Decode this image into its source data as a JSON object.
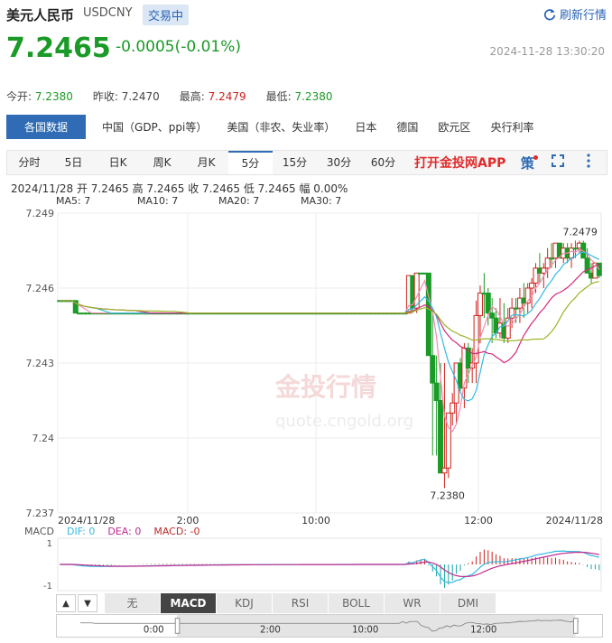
{
  "header": {
    "title": "美元人民币",
    "symbol": "USDCNY",
    "status": "交易中",
    "refresh_label": "刷新行情"
  },
  "quote": {
    "price": "7.2465",
    "change": "-0.0005(-0.01%)",
    "timestamp": "2024-11-28 13:30:20"
  },
  "stats": [
    {
      "label": "今开:",
      "value": "7.2380",
      "tone": "green"
    },
    {
      "label": "昨收:",
      "value": "7.2470",
      "tone": "neutral"
    },
    {
      "label": "最高:",
      "value": "7.2479",
      "tone": "red"
    },
    {
      "label": "最低:",
      "value": "7.2380",
      "tone": "green"
    }
  ],
  "categories": [
    "各国数据",
    "中国（GDP、ppi等）",
    "美国（非农、失业率）",
    "日本",
    "德国",
    "欧元区",
    "央行利率"
  ],
  "tabs": [
    "分时",
    "5日",
    "日K",
    "周K",
    "月K",
    "5分",
    "15分",
    "30分",
    "60分"
  ],
  "active_tab": "5分",
  "promo": "打开金投网APP",
  "bar_info": "2024/11/28  开 7.2465  高 7.2465  收 7.2465  低 7.2465  幅 0.00%",
  "ma_labels": [
    {
      "text": "MA5: 7",
      "color": "#f58bb0"
    },
    {
      "text": "MA10: 7",
      "color": "#33b9e0"
    },
    {
      "text": "MA20: 7",
      "color": "#d6287a"
    },
    {
      "text": "MA30: 7",
      "color": "#9ab526"
    }
  ],
  "macd_labels": [
    {
      "text": "MACD",
      "color": "#555"
    },
    {
      "text": "DIF: 0",
      "color": "#33b9e0"
    },
    {
      "text": "DEA: 0",
      "color": "#c02a8e"
    },
    {
      "text": "MACD: -0",
      "color": "#c02a2a"
    }
  ],
  "indicators": [
    "无",
    "MACD",
    "KDJ",
    "RSI",
    "BOLL",
    "WR",
    "DMI"
  ],
  "active_indicator": "MACD",
  "navigator_labels": [
    "0:00",
    "2:00",
    "10:00",
    "12:00"
  ],
  "watermark": "金投行情  quote.cngold.org",
  "chart_data": {
    "type": "candlestick",
    "y_ticks": [
      "7.249",
      "7.246",
      "7.243",
      "7.24",
      "7.237"
    ],
    "ylim": [
      7.237,
      7.249
    ],
    "x_ticks": [
      "2024/11/28",
      "2:00",
      "10:00",
      "12:00",
      "2024/11/28"
    ],
    "high_label": "7.2479",
    "low_label": "7.2380",
    "macd_axis": [
      "1",
      "-1"
    ],
    "candles": [
      [
        7.2455,
        7.2455,
        7.2455,
        7.2455
      ],
      [
        7.2455,
        7.2455,
        7.2455,
        7.2455
      ],
      [
        7.2455,
        7.2455,
        7.2455,
        7.2455
      ],
      [
        7.2455,
        7.2455,
        7.2455,
        7.2455
      ],
      [
        7.2455,
        7.2455,
        7.245,
        7.245
      ],
      [
        7.245,
        7.245,
        7.245,
        7.245
      ],
      [
        7.245,
        7.245,
        7.245,
        7.245
      ],
      [
        7.245,
        7.245,
        7.245,
        7.245
      ],
      [
        7.245,
        7.245,
        7.245,
        7.245
      ],
      [
        7.245,
        7.245,
        7.245,
        7.245
      ],
      [
        7.245,
        7.245,
        7.245,
        7.245
      ],
      [
        7.245,
        7.245,
        7.245,
        7.245
      ],
      [
        7.245,
        7.245,
        7.245,
        7.245
      ],
      [
        7.245,
        7.245,
        7.245,
        7.245
      ],
      [
        7.245,
        7.245,
        7.245,
        7.245
      ],
      [
        7.245,
        7.245,
        7.245,
        7.245
      ],
      [
        7.245,
        7.245,
        7.245,
        7.245
      ],
      [
        7.245,
        7.245,
        7.245,
        7.245
      ],
      [
        7.245,
        7.245,
        7.245,
        7.245
      ],
      [
        7.245,
        7.245,
        7.245,
        7.245
      ],
      [
        7.245,
        7.245,
        7.245,
        7.245
      ],
      [
        7.245,
        7.245,
        7.245,
        7.245
      ],
      [
        7.245,
        7.245,
        7.245,
        7.245
      ],
      [
        7.245,
        7.245,
        7.245,
        7.245
      ],
      [
        7.245,
        7.245,
        7.245,
        7.245
      ],
      [
        7.245,
        7.245,
        7.245,
        7.245
      ],
      [
        7.245,
        7.245,
        7.245,
        7.245
      ],
      [
        7.245,
        7.245,
        7.245,
        7.245
      ],
      [
        7.245,
        7.245,
        7.245,
        7.245
      ],
      [
        7.245,
        7.245,
        7.245,
        7.245
      ],
      [
        7.245,
        7.245,
        7.245,
        7.245
      ],
      [
        7.245,
        7.245,
        7.245,
        7.245
      ],
      [
        7.245,
        7.245,
        7.245,
        7.245
      ],
      [
        7.245,
        7.245,
        7.245,
        7.245
      ],
      [
        7.245,
        7.245,
        7.245,
        7.245
      ],
      [
        7.245,
        7.245,
        7.245,
        7.245
      ],
      [
        7.245,
        7.245,
        7.245,
        7.245
      ],
      [
        7.245,
        7.245,
        7.245,
        7.245
      ],
      [
        7.245,
        7.245,
        7.245,
        7.245
      ],
      [
        7.245,
        7.245,
        7.245,
        7.245
      ],
      [
        7.245,
        7.245,
        7.245,
        7.245
      ],
      [
        7.245,
        7.245,
        7.245,
        7.245
      ],
      [
        7.245,
        7.245,
        7.245,
        7.245
      ],
      [
        7.245,
        7.245,
        7.245,
        7.245
      ],
      [
        7.245,
        7.245,
        7.245,
        7.245
      ],
      [
        7.245,
        7.245,
        7.245,
        7.245
      ],
      [
        7.245,
        7.245,
        7.245,
        7.245
      ],
      [
        7.245,
        7.245,
        7.245,
        7.245
      ],
      [
        7.245,
        7.245,
        7.245,
        7.245
      ],
      [
        7.245,
        7.245,
        7.245,
        7.245
      ],
      [
        7.245,
        7.245,
        7.245,
        7.245
      ],
      [
        7.245,
        7.245,
        7.245,
        7.245
      ],
      [
        7.245,
        7.245,
        7.245,
        7.245
      ],
      [
        7.245,
        7.245,
        7.245,
        7.245
      ],
      [
        7.245,
        7.245,
        7.245,
        7.245
      ],
      [
        7.245,
        7.245,
        7.245,
        7.245
      ],
      [
        7.245,
        7.245,
        7.245,
        7.245
      ],
      [
        7.245,
        7.245,
        7.245,
        7.245
      ],
      [
        7.245,
        7.245,
        7.245,
        7.245
      ],
      [
        7.245,
        7.245,
        7.245,
        7.245
      ],
      [
        7.245,
        7.245,
        7.245,
        7.245
      ],
      [
        7.245,
        7.245,
        7.245,
        7.245
      ],
      [
        7.245,
        7.245,
        7.245,
        7.245
      ],
      [
        7.245,
        7.245,
        7.245,
        7.245
      ],
      [
        7.245,
        7.245,
        7.245,
        7.245
      ],
      [
        7.245,
        7.245,
        7.245,
        7.245
      ],
      [
        7.245,
        7.245,
        7.245,
        7.245
      ],
      [
        7.245,
        7.245,
        7.245,
        7.245
      ],
      [
        7.245,
        7.245,
        7.245,
        7.245
      ],
      [
        7.245,
        7.245,
        7.245,
        7.245
      ],
      [
        7.245,
        7.245,
        7.245,
        7.245
      ],
      [
        7.245,
        7.245,
        7.245,
        7.245
      ],
      [
        7.245,
        7.245,
        7.245,
        7.245
      ],
      [
        7.245,
        7.245,
        7.245,
        7.245
      ],
      [
        7.245,
        7.245,
        7.245,
        7.245
      ],
      [
        7.245,
        7.245,
        7.245,
        7.245
      ],
      [
        7.245,
        7.245,
        7.245,
        7.245
      ],
      [
        7.245,
        7.245,
        7.245,
        7.245
      ],
      [
        7.245,
        7.245,
        7.245,
        7.245
      ],
      [
        7.245,
        7.245,
        7.245,
        7.245
      ],
      [
        7.245,
        7.245,
        7.245,
        7.245
      ],
      [
        7.245,
        7.245,
        7.245,
        7.245
      ],
      [
        7.245,
        7.245,
        7.245,
        7.245
      ],
      [
        7.245,
        7.245,
        7.245,
        7.245
      ],
      [
        7.245,
        7.245,
        7.245,
        7.245
      ],
      [
        7.245,
        7.245,
        7.245,
        7.245
      ],
      [
        7.245,
        7.245,
        7.245,
        7.245
      ],
      [
        7.245,
        7.245,
        7.245,
        7.245
      ],
      [
        7.245,
        7.2465,
        7.245,
        7.2465
      ],
      [
        7.2465,
        7.2465,
        7.245,
        7.2452
      ],
      [
        7.2452,
        7.2466,
        7.245,
        7.2466
      ],
      [
        7.2466,
        7.2466,
        7.2466,
        7.2466
      ],
      [
        7.2466,
        7.2466,
        7.2466,
        7.2466
      ],
      [
        7.2466,
        7.2466,
        7.2433,
        7.2433
      ],
      [
        7.2433,
        7.245,
        7.2393,
        7.2422
      ],
      [
        7.2422,
        7.2433,
        7.2393,
        7.2415
      ],
      [
        7.2415,
        7.243,
        7.2386,
        7.2386
      ],
      [
        7.2386,
        7.243,
        7.238,
        7.2388
      ],
      [
        7.2388,
        7.241,
        7.2384,
        7.241
      ],
      [
        7.241,
        7.2418,
        7.2405,
        7.2414
      ],
      [
        7.2414,
        7.243,
        7.2406,
        7.243
      ],
      [
        7.243,
        7.2432,
        7.2418,
        7.242
      ],
      [
        7.242,
        7.2438,
        7.2412,
        7.2436
      ],
      [
        7.2436,
        7.2438,
        7.2422,
        7.2428
      ],
      [
        7.2428,
        7.2436,
        7.2422,
        7.243
      ],
      [
        7.243,
        7.2455,
        7.2422,
        7.2449
      ],
      [
        7.2449,
        7.2461,
        7.2438,
        7.2458
      ],
      [
        7.2458,
        7.2466,
        7.2448,
        7.2458
      ],
      [
        7.2458,
        7.246,
        7.2445,
        7.245
      ],
      [
        7.245,
        7.2456,
        7.2438,
        7.2448
      ],
      [
        7.2448,
        7.2452,
        7.244,
        7.2442
      ],
      [
        7.2442,
        7.2456,
        7.244,
        7.2446
      ],
      [
        7.2446,
        7.2454,
        7.2438,
        7.244
      ],
      [
        7.244,
        7.2452,
        7.2438,
        7.2448
      ],
      [
        7.2448,
        7.2456,
        7.2444,
        7.2452
      ],
      [
        7.2452,
        7.2456,
        7.2446,
        7.2452
      ],
      [
        7.2452,
        7.246,
        7.2446,
        7.2456
      ],
      [
        7.2456,
        7.2462,
        7.2448,
        7.2454
      ],
      [
        7.2454,
        7.2462,
        7.245,
        7.246
      ],
      [
        7.246,
        7.2464,
        7.2452,
        7.2462
      ],
      [
        7.2462,
        7.247,
        7.2458,
        7.2468
      ],
      [
        7.2468,
        7.2474,
        7.2462,
        7.2466
      ],
      [
        7.2466,
        7.247,
        7.246,
        7.2468
      ],
      [
        7.2468,
        7.2476,
        7.2464,
        7.2472
      ],
      [
        7.2472,
        7.2478,
        7.2468,
        7.2472
      ],
      [
        7.2472,
        7.2478,
        7.2468,
        7.2478
      ],
      [
        7.2478,
        7.2478,
        7.2472,
        7.2472
      ],
      [
        7.2472,
        7.2478,
        7.247,
        7.2476
      ],
      [
        7.2476,
        7.2478,
        7.247,
        7.2472
      ],
      [
        7.2472,
        7.2478,
        7.2468,
        7.2476
      ],
      [
        7.2476,
        7.2479,
        7.2472,
        7.2476
      ],
      [
        7.2476,
        7.2479,
        7.2474,
        7.2478
      ],
      [
        7.2478,
        7.2479,
        7.2472,
        7.2472
      ],
      [
        7.2472,
        7.2476,
        7.2466,
        7.2466
      ],
      [
        7.2466,
        7.247,
        7.2462,
        7.2464
      ],
      [
        7.2464,
        7.247,
        7.2464,
        7.247
      ],
      [
        7.247,
        7.247,
        7.2464,
        7.2465
      ]
    ]
  }
}
